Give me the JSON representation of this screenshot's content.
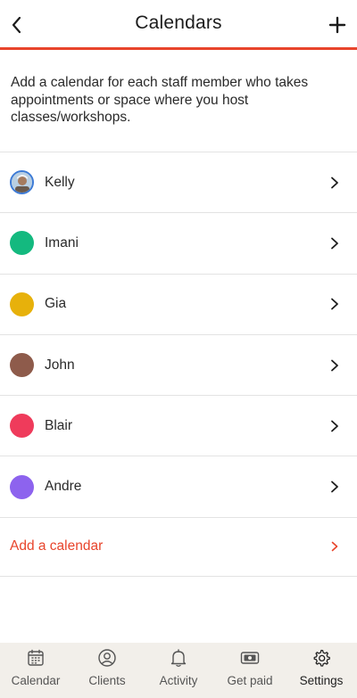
{
  "header": {
    "title": "Calendars"
  },
  "intro": "Add a calendar for each staff member who takes appointments or space where you host classes/workshops.",
  "calendars": [
    {
      "name": "Kelly",
      "color": "#3d7bd6",
      "avatar": true
    },
    {
      "name": "Imani",
      "color": "#14b97f"
    },
    {
      "name": "Gia",
      "color": "#e7b10b"
    },
    {
      "name": "John",
      "color": "#8e5b4b"
    },
    {
      "name": "Blair",
      "color": "#ef3b5b"
    },
    {
      "name": "Andre",
      "color": "#8d63ee"
    }
  ],
  "add_calendar_label": "Add a calendar",
  "accent_color": "#e8442b",
  "tabs": [
    {
      "label": "Calendar",
      "icon": "calendar-icon"
    },
    {
      "label": "Clients",
      "icon": "person-circle-icon"
    },
    {
      "label": "Activity",
      "icon": "bell-icon"
    },
    {
      "label": "Get paid",
      "icon": "money-icon"
    },
    {
      "label": "Settings",
      "icon": "gear-icon",
      "active": true
    }
  ]
}
